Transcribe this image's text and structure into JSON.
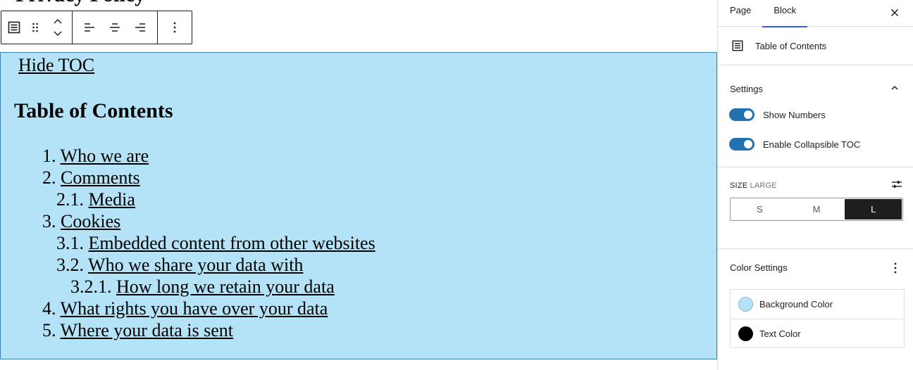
{
  "canvas": {
    "cut_heading": "Privacy Policy",
    "toc": {
      "hide_label": "Hide TOC",
      "title": "Table of Contents",
      "items": [
        {
          "num": "1.",
          "text": "Who we are",
          "level": 1
        },
        {
          "num": "2.",
          "text": "Comments",
          "level": 1
        },
        {
          "num": "2.1.",
          "text": "Media",
          "level": 2
        },
        {
          "num": "3.",
          "text": "Cookies",
          "level": 1
        },
        {
          "num": "3.1.",
          "text": "Embedded content from other websites",
          "level": 2
        },
        {
          "num": "3.2.",
          "text": "Who we share your data with",
          "level": 2
        },
        {
          "num": "3.2.1.",
          "text": "How long we retain your data",
          "level": 3
        },
        {
          "num": "4.",
          "text": "What rights you have over your data",
          "level": 1
        },
        {
          "num": "5.",
          "text": "Where your data is sent",
          "level": 1
        }
      ]
    },
    "toolbar": {
      "icons": [
        "table-of-contents-icon",
        "drag-handle-icon",
        "move-up-icon",
        "move-down-icon",
        "align-left-icon",
        "align-center-icon",
        "align-right-icon",
        "more-options-icon"
      ]
    }
  },
  "sidebar": {
    "tabs": [
      {
        "label": "Page",
        "active": false
      },
      {
        "label": "Block",
        "active": true
      }
    ],
    "block_card": {
      "title": "Table of Contents",
      "icon": "table-of-contents-icon"
    },
    "settings": {
      "title": "Settings",
      "toggles": [
        {
          "label": "Show Numbers",
          "on": true
        },
        {
          "label": "Enable Collapsible TOC",
          "on": true
        }
      ]
    },
    "size": {
      "label": "Size",
      "value": "Large",
      "options": [
        "S",
        "M",
        "L"
      ],
      "selected": "L"
    },
    "color_settings": {
      "title": "Color Settings",
      "items": [
        {
          "label": "Background Color",
          "color": "#b4e3f7"
        },
        {
          "label": "Text Color",
          "color": "#000000"
        }
      ]
    }
  },
  "colors": {
    "accent": "#3858e9",
    "toggle_on": "#2271b1",
    "block_bg": "#b4e3f7",
    "block_border": "#3a7fb5"
  }
}
